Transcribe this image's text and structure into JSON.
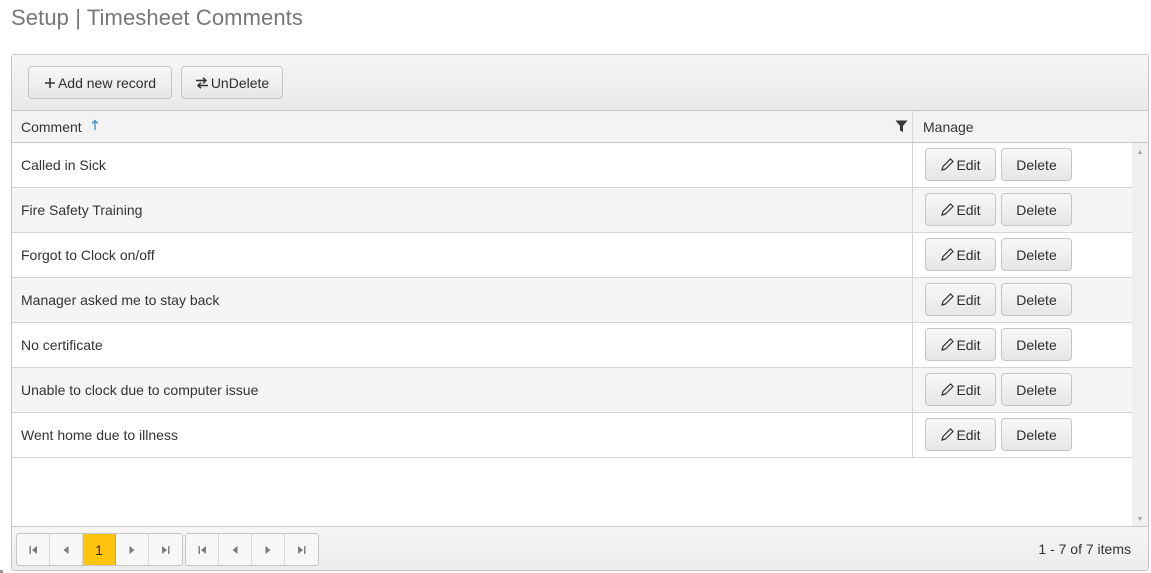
{
  "page": {
    "title": "Setup | Timesheet Comments"
  },
  "toolbar": {
    "add_label": "Add new record",
    "undelete_label": "UnDelete"
  },
  "columns": {
    "comment": "Comment",
    "manage": "Manage"
  },
  "sort": {
    "column": "Comment",
    "direction": "ascending"
  },
  "rows": [
    {
      "comment": "Called in Sick",
      "edit": "Edit",
      "delete": "Delete"
    },
    {
      "comment": "Fire Safety Training",
      "edit": "Edit",
      "delete": "Delete"
    },
    {
      "comment": "Forgot to Clock on/off",
      "edit": "Edit",
      "delete": "Delete"
    },
    {
      "comment": "Manager asked me to stay back",
      "edit": "Edit",
      "delete": "Delete"
    },
    {
      "comment": "No certificate",
      "edit": "Edit",
      "delete": "Delete"
    },
    {
      "comment": "Unable to clock due to computer issue",
      "edit": "Edit",
      "delete": "Delete"
    },
    {
      "comment": "Went home due to illness",
      "edit": "Edit",
      "delete": "Delete"
    }
  ],
  "pager": {
    "current_page": "1",
    "info": "1 - 7 of 7 items"
  },
  "colors": {
    "accent_page": "#ffc40d",
    "sort_arrow": "#3f8fd2",
    "title": "#777777"
  },
  "icons": {
    "add": "plus-icon",
    "undelete": "swap-arrows-icon",
    "sort": "sort-ascending-icon",
    "filter": "filter-icon",
    "edit": "pencil-icon",
    "first": "first-page-icon",
    "prev": "previous-page-icon",
    "next": "next-page-icon",
    "last": "last-page-icon"
  }
}
